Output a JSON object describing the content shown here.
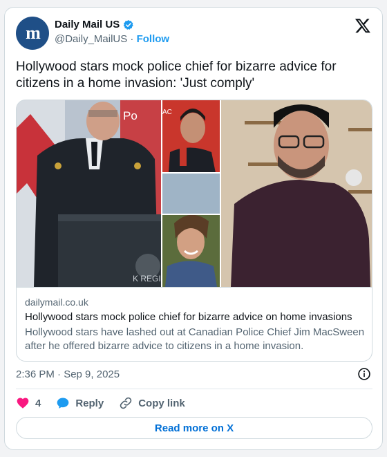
{
  "author": {
    "avatar_text": "m",
    "name": "Daily Mail US",
    "handle": "@Daily_MailUS",
    "separator": "·",
    "follow_label": "Follow"
  },
  "tweet": {
    "text": "Hollywood stars mock police chief for bizarre advice for citizens in a home invasion: 'Just comply'",
    "timestamp": "2:36 PM · Sep 9, 2025"
  },
  "link_card": {
    "domain": "dailymail.co.uk",
    "title": "Hollywood stars mock police chief for bizarre advice on home invasions",
    "description": "Hollywood stars have lashed out at Canadian Police Chief Jim MacSween after he offered bizarre advice to citizens in a home invasion.",
    "photo_texts": {
      "police_sign": "Po",
      "crest": "K REGI",
      "mic_flag": "AC"
    }
  },
  "actions": {
    "like_count": "4",
    "reply_label": "Reply",
    "copy_label": "Copy link"
  },
  "read_more_label": "Read more on X",
  "colors": {
    "brand_blue": "#1d9bf0",
    "like_pink": "#f91880",
    "link_blue": "#006fd6",
    "avatar_bg": "#1f4f87"
  },
  "icons": [
    "verified-icon",
    "x-logo-icon",
    "info-icon",
    "heart-icon",
    "reply-icon",
    "link-icon"
  ]
}
